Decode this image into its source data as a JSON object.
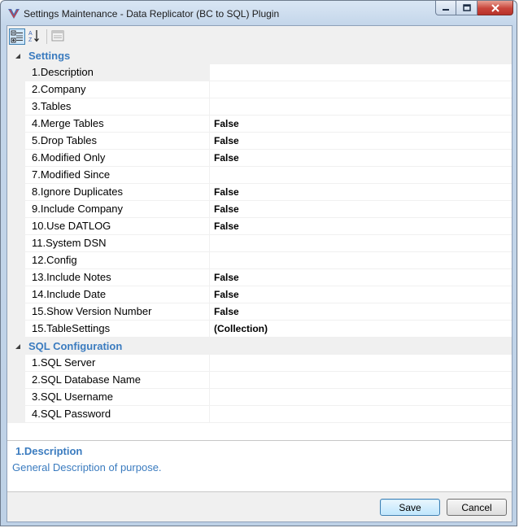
{
  "window": {
    "title": "Settings Maintenance - Data Replicator (BC to SQL) Plugin"
  },
  "toolbar": {
    "categorized_icon": "categorized-view-icon",
    "alphabetical_icon": "alphabetical-sort-icon",
    "pages_icon": "property-pages-icon"
  },
  "grid": {
    "categories": [
      {
        "label": "Settings",
        "properties": [
          {
            "name": "1.Description",
            "value": ""
          },
          {
            "name": "2.Company",
            "value": ""
          },
          {
            "name": "3.Tables",
            "value": ""
          },
          {
            "name": "4.Merge Tables",
            "value": "False"
          },
          {
            "name": "5.Drop Tables",
            "value": "False"
          },
          {
            "name": "6.Modified Only",
            "value": "False"
          },
          {
            "name": "7.Modified Since",
            "value": ""
          },
          {
            "name": "8.Ignore Duplicates",
            "value": "False"
          },
          {
            "name": "9.Include Company",
            "value": "False"
          },
          {
            "name": "10.Use DATLOG",
            "value": "False"
          },
          {
            "name": "11.System DSN",
            "value": ""
          },
          {
            "name": "12.Config",
            "value": ""
          },
          {
            "name": "13.Include Notes",
            "value": "False"
          },
          {
            "name": "14.Include Date",
            "value": "False"
          },
          {
            "name": "15.Show Version Number",
            "value": "False"
          },
          {
            "name": "15.TableSettings",
            "value": "(Collection)"
          }
        ]
      },
      {
        "label": "SQL Configuration",
        "properties": [
          {
            "name": "1.SQL Server",
            "value": ""
          },
          {
            "name": "2.SQL Database Name",
            "value": ""
          },
          {
            "name": "3.SQL Username",
            "value": ""
          },
          {
            "name": "4.SQL Password",
            "value": ""
          }
        ]
      }
    ]
  },
  "description": {
    "title": "1.Description",
    "text": "General Description of purpose."
  },
  "buttons": {
    "save": "Save",
    "cancel": "Cancel"
  },
  "colors": {
    "accent": "#3a7bbf",
    "close_button": "#c8453a"
  }
}
